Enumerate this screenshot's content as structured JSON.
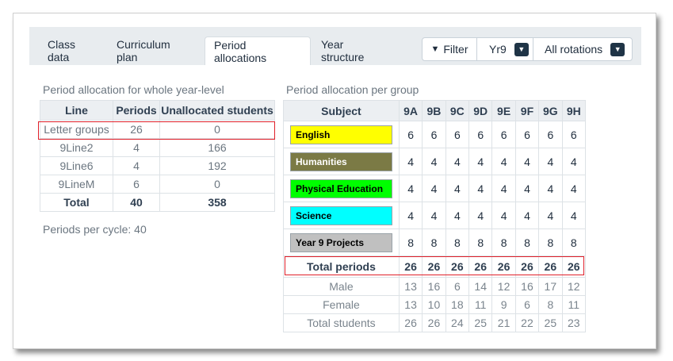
{
  "tabs": [
    {
      "label": "Class data"
    },
    {
      "label": "Curriculum plan"
    },
    {
      "label": "Period allocations"
    },
    {
      "label": "Year structure"
    }
  ],
  "filter_bar": {
    "filter_label": "Filter",
    "year_value": "Yr9",
    "rotation_value": "All rotations"
  },
  "year_level": {
    "title": "Period allocation for whole year-level",
    "headers": [
      "Line",
      "Periods",
      "Unallocated students"
    ],
    "rows": [
      [
        "Letter groups",
        "26",
        "0"
      ],
      [
        "9Line2",
        "4",
        "166"
      ],
      [
        "9Line6",
        "4",
        "192"
      ],
      [
        "9LineM",
        "6",
        "0"
      ]
    ],
    "total": [
      "Total",
      "40",
      "358"
    ],
    "periods_per_cycle_label": "Periods per cycle:",
    "periods_per_cycle_value": "40"
  },
  "per_group": {
    "title": "Period allocation per group",
    "subject_header": "Subject",
    "groups": [
      "9A",
      "9B",
      "9C",
      "9D",
      "9E",
      "9F",
      "9G",
      "9H"
    ],
    "subjects": [
      {
        "name": "English",
        "color": "#ffff00",
        "text_color": "#000000",
        "values": [
          "6",
          "6",
          "6",
          "6",
          "6",
          "6",
          "6",
          "6"
        ]
      },
      {
        "name": "Humanities",
        "color": "#7b7a45",
        "text_color": "#ffffff",
        "values": [
          "4",
          "4",
          "4",
          "4",
          "4",
          "4",
          "4",
          "4"
        ]
      },
      {
        "name": "Physical Education",
        "color": "#00ff00",
        "text_color": "#000000",
        "values": [
          "4",
          "4",
          "4",
          "4",
          "4",
          "4",
          "4",
          "4"
        ]
      },
      {
        "name": "Science",
        "color": "#00ffff",
        "text_color": "#000000",
        "values": [
          "4",
          "4",
          "4",
          "4",
          "4",
          "4",
          "4",
          "4"
        ]
      },
      {
        "name": "Year 9 Projects",
        "color": "#c0c0c0",
        "text_color": "#000000",
        "values": [
          "8",
          "8",
          "8",
          "8",
          "8",
          "8",
          "8",
          "8"
        ]
      }
    ],
    "total_periods": {
      "label": "Total periods",
      "values": [
        "26",
        "26",
        "26",
        "26",
        "26",
        "26",
        "26",
        "26"
      ]
    },
    "stats": [
      {
        "label": "Male",
        "values": [
          "13",
          "16",
          "6",
          "14",
          "12",
          "16",
          "17",
          "12"
        ]
      },
      {
        "label": "Female",
        "values": [
          "13",
          "10",
          "18",
          "11",
          "9",
          "6",
          "8",
          "11"
        ]
      },
      {
        "label": "Total students",
        "values": [
          "26",
          "26",
          "24",
          "25",
          "21",
          "22",
          "25",
          "23"
        ]
      }
    ]
  },
  "colors": {
    "highlight": "#e0202a",
    "tab_bar": "#e8ecef",
    "dark_caret": "#1f3446"
  }
}
